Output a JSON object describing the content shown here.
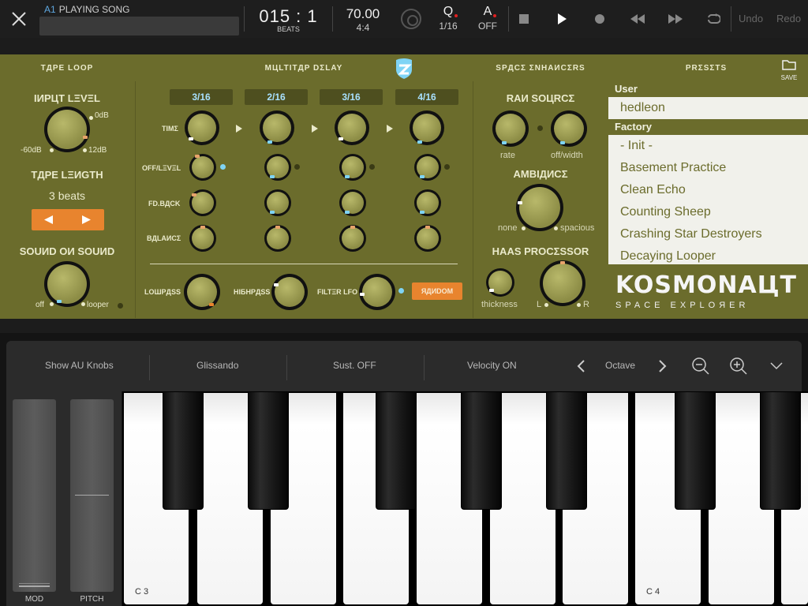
{
  "topbar": {
    "track_id": "A1",
    "song_title": "PLAYING SONG",
    "position": "015 : 1",
    "position_unit": "BEATS",
    "tempo": "70.00",
    "time_signature": "4:4",
    "quantize_label": "Q",
    "quantize_value": "1/16",
    "auto_label": "A",
    "auto_value": "OFF",
    "undo": "Undo",
    "redo": "Redo"
  },
  "plugin": {
    "sections": {
      "tape_loop": "TДPE LOOP",
      "multitap_delay": "MЦLTITДP DΣLAY",
      "space_enhancers": "SPДCΣ ΣNHAИCΣRS",
      "presets": "PRΣSΣTS"
    },
    "save_label": "SAVE",
    "tape_loop": {
      "input_level": "IИPЦT LΞVΞL",
      "input_min": "-60dB",
      "input_mid": "0dB",
      "input_max": "12dB",
      "tape_length": "TДPE LΞИGTH",
      "tape_length_value": "3 beats",
      "sound_on_sound": "SOUИD OИ SOUИD",
      "sos_min": "off",
      "sos_max": "looper"
    },
    "delay": {
      "divisions": [
        "3/16",
        "2/16",
        "3/16",
        "4/16"
      ],
      "row_time": "TIMΣ",
      "row_level": "OFF/LΞVΞL",
      "row_feedback": "FD.BДCK",
      "row_balance": "BДLAИCΣ",
      "lowpass": "LOШPДSS",
      "highpass": "HIБHPДSS",
      "filter_lfo": "FILTΞR LFO",
      "random": "ЯДИDOM"
    },
    "space": {
      "rain_source": "RAИ SOЦRCΣ",
      "rate": "rate",
      "off_width": "off/width",
      "ambience": "AMBIДИCΣ",
      "none": "none",
      "spacious": "spacious",
      "haas": "HAAS PROCΣSSOR",
      "thickness": "thickness",
      "left": "L",
      "right": "R"
    },
    "presets": {
      "user_header": "User",
      "user_items": [
        "hedleon"
      ],
      "factory_header": "Factory",
      "factory_items": [
        "- Init -",
        "Basement Practice",
        "Clean Echo",
        "Counting Sheep",
        "Crashing Star Destroyers",
        "Decaying Looper"
      ]
    },
    "logo": {
      "name": "KOSMONAЦT",
      "tagline": "SPACE EXPLOЯER"
    },
    "colors": {
      "panel": "#6b6c2c",
      "accent": "#e8842e",
      "indicator": "#7fd4f5"
    }
  },
  "keyboard": {
    "toolbar": {
      "show_knobs": "Show AU Knobs",
      "glissando": "Glissando",
      "sustain": "Sust. OFF",
      "velocity": "Velocity ON",
      "octave": "Octave"
    },
    "wheels": {
      "mod": "MOD",
      "pitch": "PITCH"
    },
    "key_labels": {
      "c3": "C 3",
      "c4": "C 4"
    }
  }
}
